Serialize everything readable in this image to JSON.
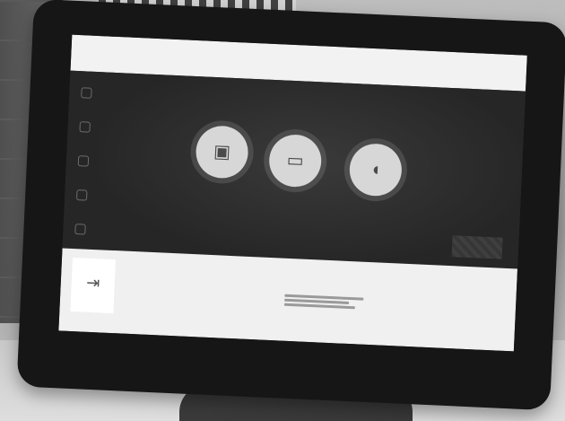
{
  "photo": {
    "description_subject": "tablet-room-booking-display"
  },
  "screen": {
    "topbar": {
      "title": "",
      "right_label": ""
    },
    "sidebar": {
      "icons": [
        "nav-icon-1",
        "nav-icon-2",
        "nav-icon-3",
        "nav-icon-4",
        "nav-icon-5"
      ]
    },
    "actions": [
      {
        "name": "camera-button",
        "icon": "camera-icon",
        "glyph": "▣"
      },
      {
        "name": "screen-share-button",
        "icon": "screen-share-icon",
        "glyph": "▭"
      },
      {
        "name": "microphone-button",
        "icon": "microphone-icon",
        "glyph": "◖"
      }
    ],
    "bottom": {
      "exit_label": "",
      "meeting_title": "",
      "time_range": ""
    }
  }
}
